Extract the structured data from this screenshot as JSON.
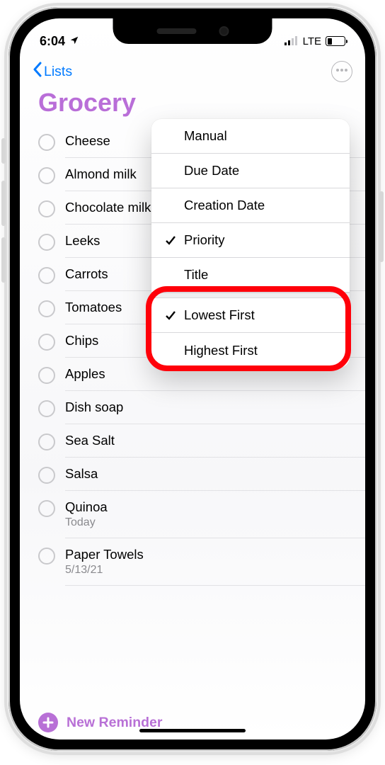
{
  "status": {
    "time": "6:04",
    "network_label": "LTE"
  },
  "nav": {
    "back_label": "Lists"
  },
  "list": {
    "title": "Grocery",
    "accent_color": "#b96ed8"
  },
  "reminders": [
    {
      "title": "Cheese",
      "subtitle": null
    },
    {
      "title": "Almond milk",
      "subtitle": null
    },
    {
      "title": "Chocolate milk",
      "subtitle": null
    },
    {
      "title": "Leeks",
      "subtitle": null
    },
    {
      "title": "Carrots",
      "subtitle": null
    },
    {
      "title": "Tomatoes",
      "subtitle": null
    },
    {
      "title": "Chips",
      "subtitle": null
    },
    {
      "title": "Apples",
      "subtitle": null
    },
    {
      "title": "Dish soap",
      "subtitle": null
    },
    {
      "title": "Sea Salt",
      "subtitle": null
    },
    {
      "title": "Salsa",
      "subtitle": null
    },
    {
      "title": "Quinoa",
      "subtitle": "Today"
    },
    {
      "title": "Paper Towels",
      "subtitle": "5/13/21"
    }
  ],
  "sort_menu": {
    "items": [
      {
        "label": "Manual",
        "checked": false
      },
      {
        "label": "Due Date",
        "checked": false
      },
      {
        "label": "Creation Date",
        "checked": false
      },
      {
        "label": "Priority",
        "checked": true
      },
      {
        "label": "Title",
        "checked": false
      }
    ],
    "order_items": [
      {
        "label": "Lowest First",
        "checked": true
      },
      {
        "label": "Highest First",
        "checked": false
      }
    ]
  },
  "footer": {
    "new_reminder_label": "New Reminder"
  }
}
